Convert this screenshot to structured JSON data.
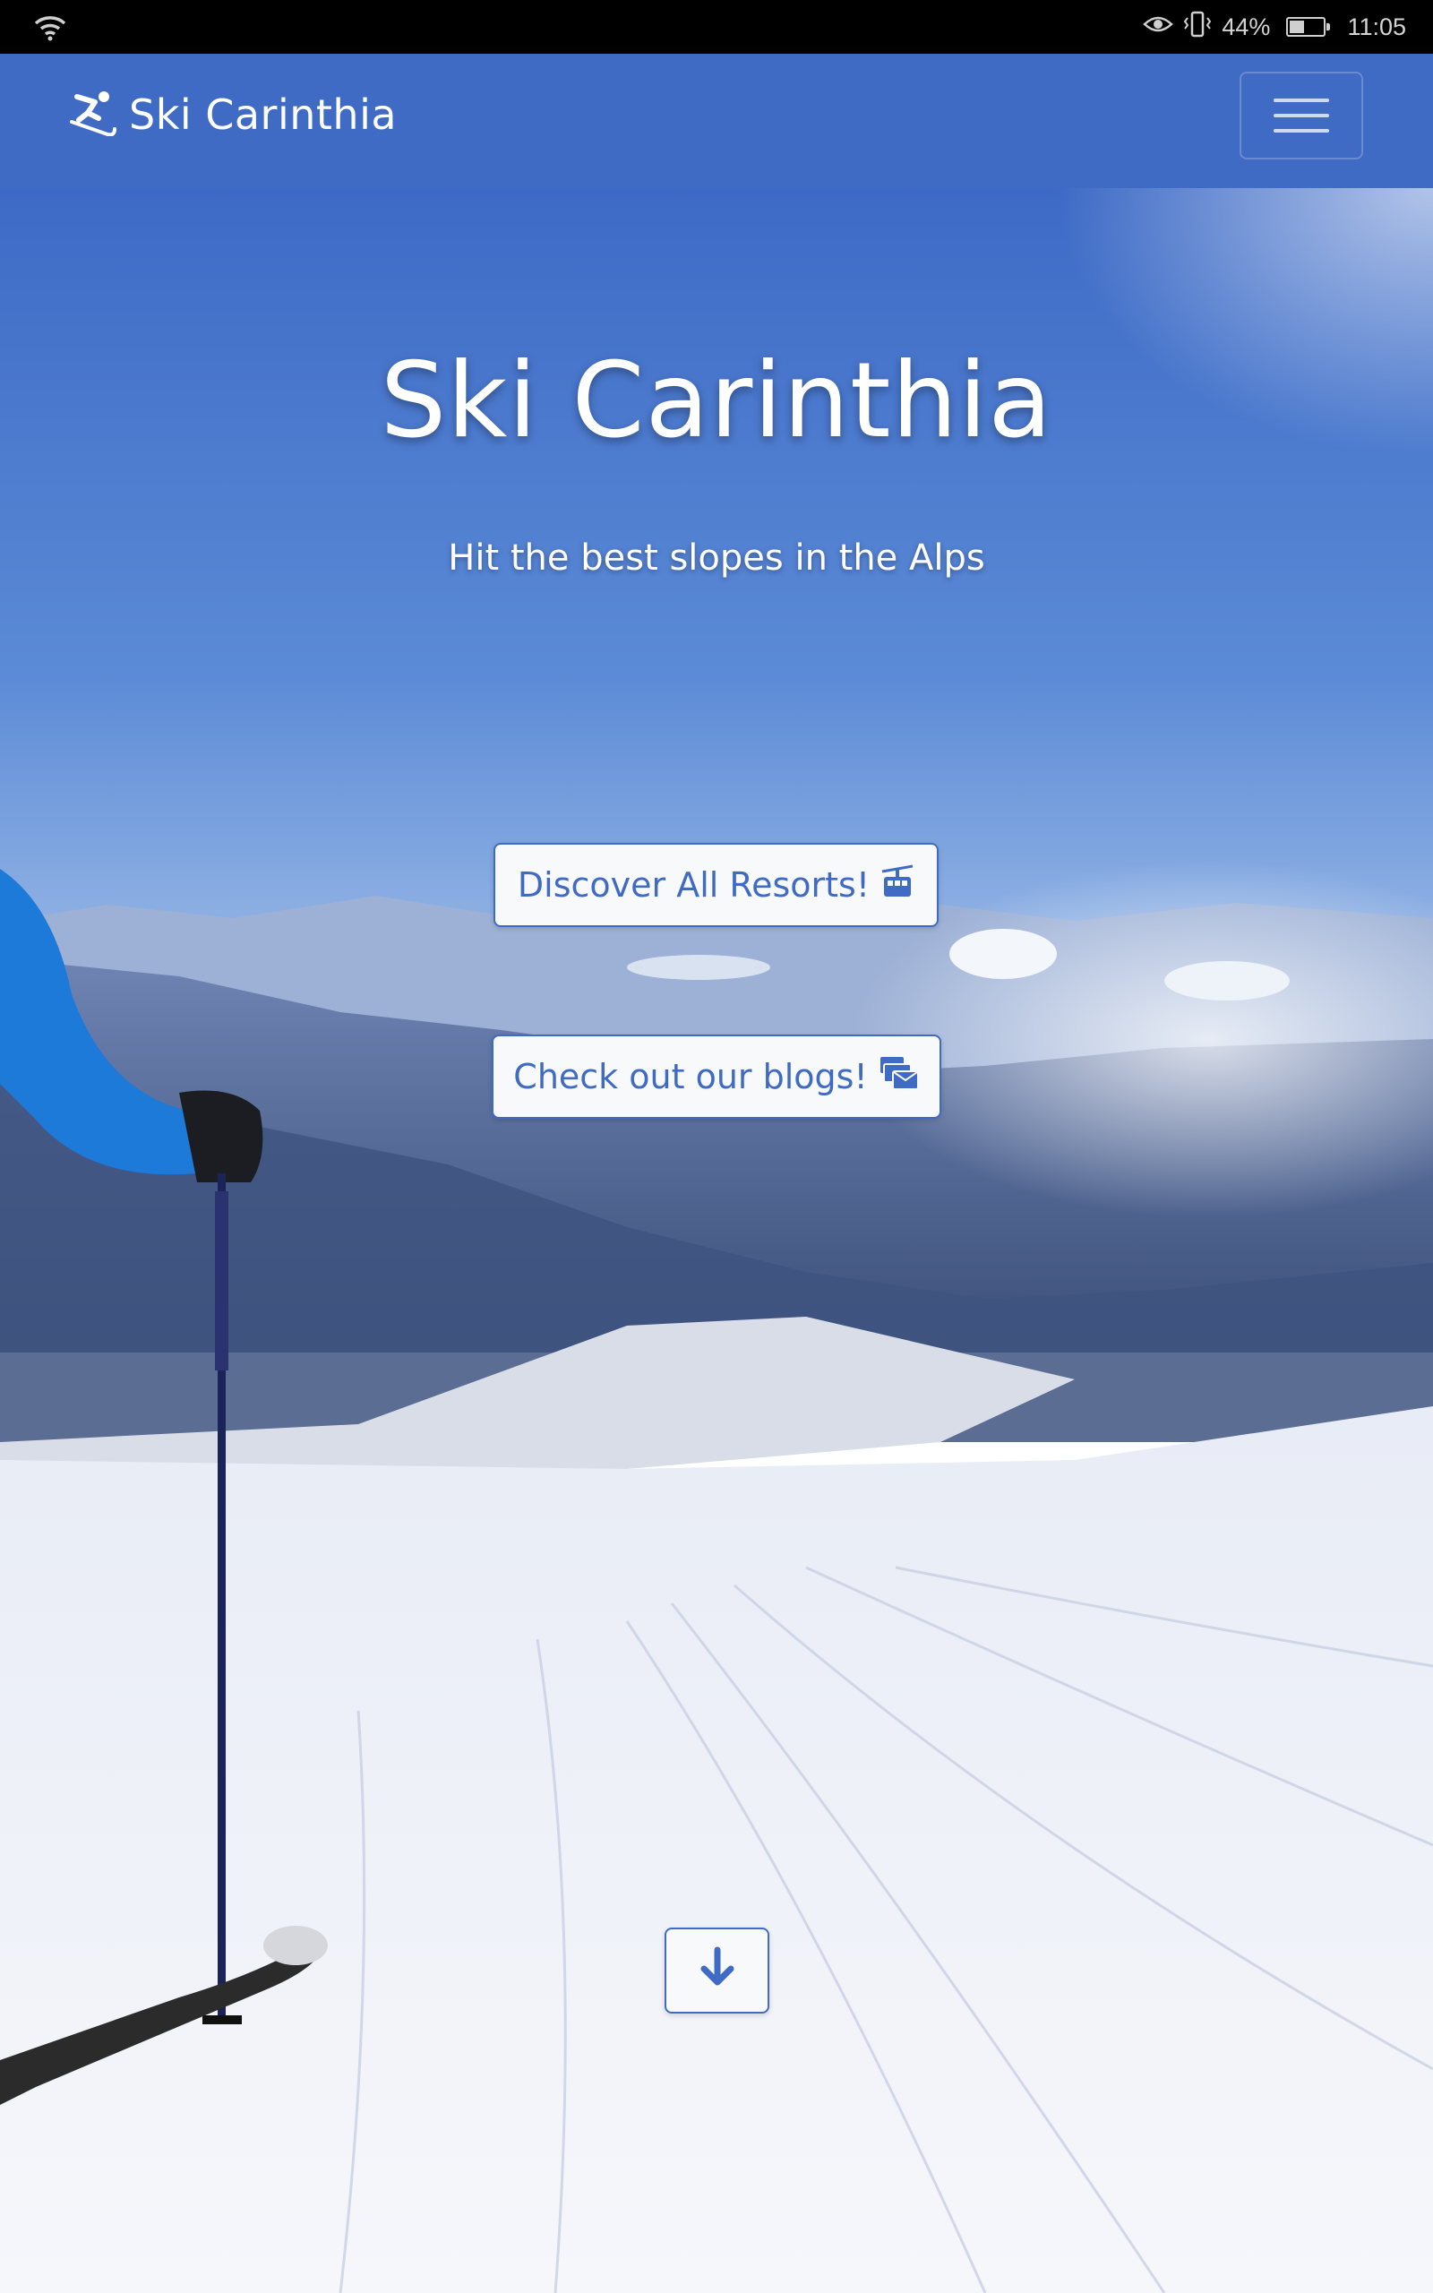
{
  "status_bar": {
    "battery_percent": "44%",
    "time": "11:05",
    "battery_level": 0.44,
    "icons": [
      "wifi-icon",
      "eye-comfort-icon",
      "vibrate-icon",
      "battery-icon"
    ]
  },
  "navbar": {
    "brand": "Ski Carinthia",
    "brand_icon": "skiing-icon",
    "menu_icon": "hamburger-menu-icon",
    "background_color": "#3f6bc4"
  },
  "hero": {
    "title": "Ski Carinthia",
    "subtitle": "Hit the best slopes in the Alps",
    "buttons": {
      "resorts": {
        "label": "Discover All Resorts!",
        "icon": "cable-car-icon"
      },
      "blogs": {
        "label": "Check out our blogs!",
        "icon": "mail-bulk-icon"
      },
      "scroll_down": {
        "icon": "arrow-down-icon"
      }
    },
    "accent_color": "#3f6bc4"
  }
}
